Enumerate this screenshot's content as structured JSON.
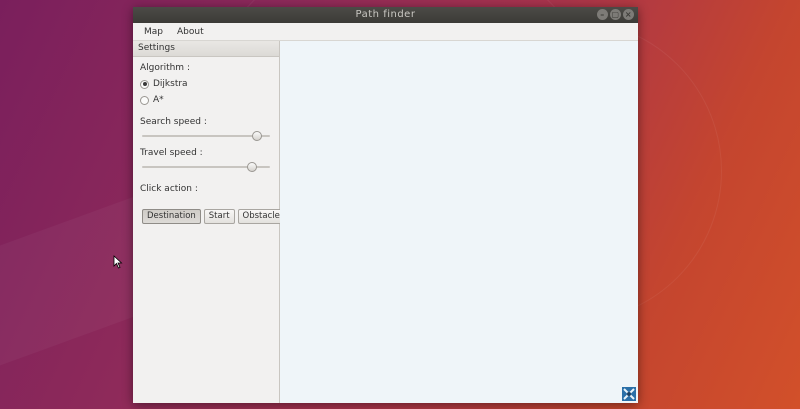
{
  "window": {
    "title": "Path finder",
    "controls": {
      "minimize": "–",
      "maximize": "▢",
      "close": "×"
    }
  },
  "menu": [
    "Map",
    "About"
  ],
  "sidebar": {
    "header": "Settings",
    "algorithm_label": "Algorithm :",
    "algorithms": [
      {
        "label": "Dijkstra",
        "checked": true
      },
      {
        "label": "A*",
        "checked": false
      }
    ],
    "search_speed_label": "Search speed :",
    "search_speed_level": 0.9,
    "travel_speed_label": "Travel speed :",
    "travel_speed_level": 0.86,
    "click_action_label": "Click action :",
    "actions": [
      {
        "label": "Destination",
        "active": true
      },
      {
        "label": "Start",
        "active": false
      },
      {
        "label": "Obstacle",
        "active": false
      }
    ]
  },
  "colors": {
    "canvas_bg": "#eff5f9",
    "window_bg": "#f2f1f0",
    "titlebar": "#3c3b37"
  }
}
